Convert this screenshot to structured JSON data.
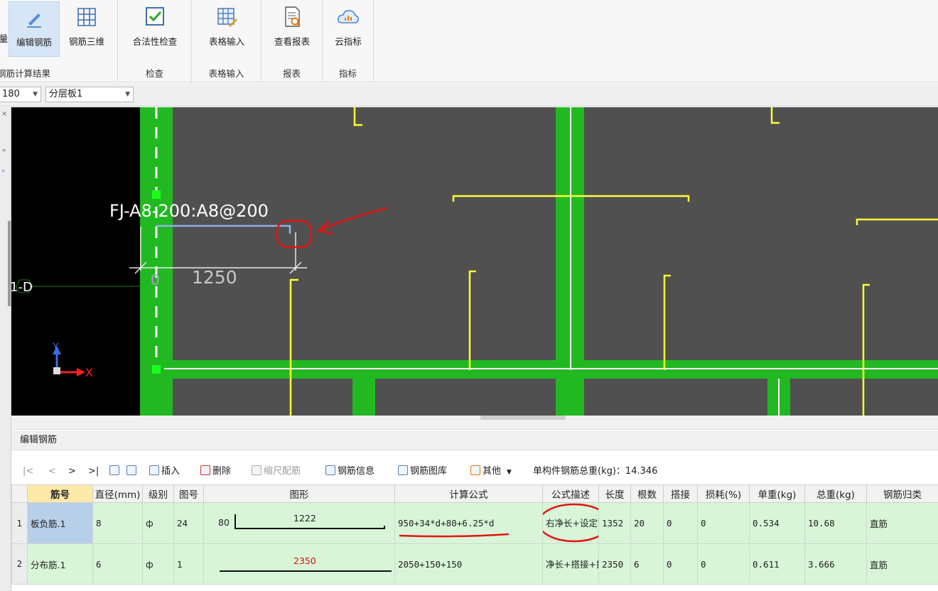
{
  "ribbon": {
    "groups": [
      {
        "label": "钢筋计算结果",
        "buttons": [
          {
            "label": "量"
          },
          {
            "label": "编辑钢筋"
          },
          {
            "label": "钢筋三维"
          }
        ]
      },
      {
        "label": "检查",
        "buttons": [
          {
            "label": "合法性检查"
          }
        ]
      },
      {
        "label": "表格输入",
        "buttons": [
          {
            "label": "表格输入"
          }
        ]
      },
      {
        "label": "报表",
        "buttons": [
          {
            "label": "查看报表"
          }
        ]
      },
      {
        "label": "指标",
        "buttons": [
          {
            "label": "云指标"
          }
        ]
      }
    ],
    "active_button": "编辑钢筋"
  },
  "selectors": {
    "first": "180",
    "second": "分层板1"
  },
  "canvas": {
    "rebar_label": "FJ-A8-200:A8@200",
    "dimension": "1250",
    "zero": "0",
    "grid_label": "1-D",
    "axis_x": "X",
    "axis_y": "Y"
  },
  "panel": {
    "title": "编辑钢筋"
  },
  "toolbar": {
    "nav": [
      "|<",
      "<",
      ">",
      ">|"
    ],
    "insert": "插入",
    "delete": "删除",
    "scale": "缩尺配筋",
    "info": "钢筋信息",
    "library": "钢筋图库",
    "other": "其他",
    "total_label": "单构件钢筋总重(kg)：14.346"
  },
  "table": {
    "headers": [
      "筋号",
      "直径(mm)",
      "级别",
      "图号",
      "图形",
      "计算公式",
      "公式描述",
      "长度",
      "根数",
      "搭接",
      "损耗(%)",
      "单重(kg)",
      "总重(kg)",
      "钢筋归类"
    ],
    "rows": [
      {
        "no": "1",
        "name": "板负筋.1",
        "dia": "8",
        "grade": "ф",
        "fig": "24",
        "shape_left": "80",
        "shape_main": "1222",
        "formula": "950+34*d+80+6.25*d",
        "desc": "右净长+设定锚固+弯折+弯钩",
        "length": "1352",
        "count": "20",
        "lap": "0",
        "loss": "0",
        "unit": "0.534",
        "total": "10.68",
        "type": "直筋"
      },
      {
        "no": "2",
        "name": "分布筋.1",
        "dia": "6",
        "grade": "ф",
        "fig": "1",
        "shape_left": "",
        "shape_main": "2350",
        "formula": "2050+150+150",
        "desc": "净长+搭接+搭接",
        "length": "2350",
        "count": "6",
        "lap": "0",
        "loss": "0",
        "unit": "0.611",
        "total": "3.666",
        "type": "直筋"
      }
    ]
  },
  "colors": {
    "slab": "#505050",
    "beam": "#22b822",
    "rebar": "#ffff33",
    "annotation": "#e51212"
  }
}
